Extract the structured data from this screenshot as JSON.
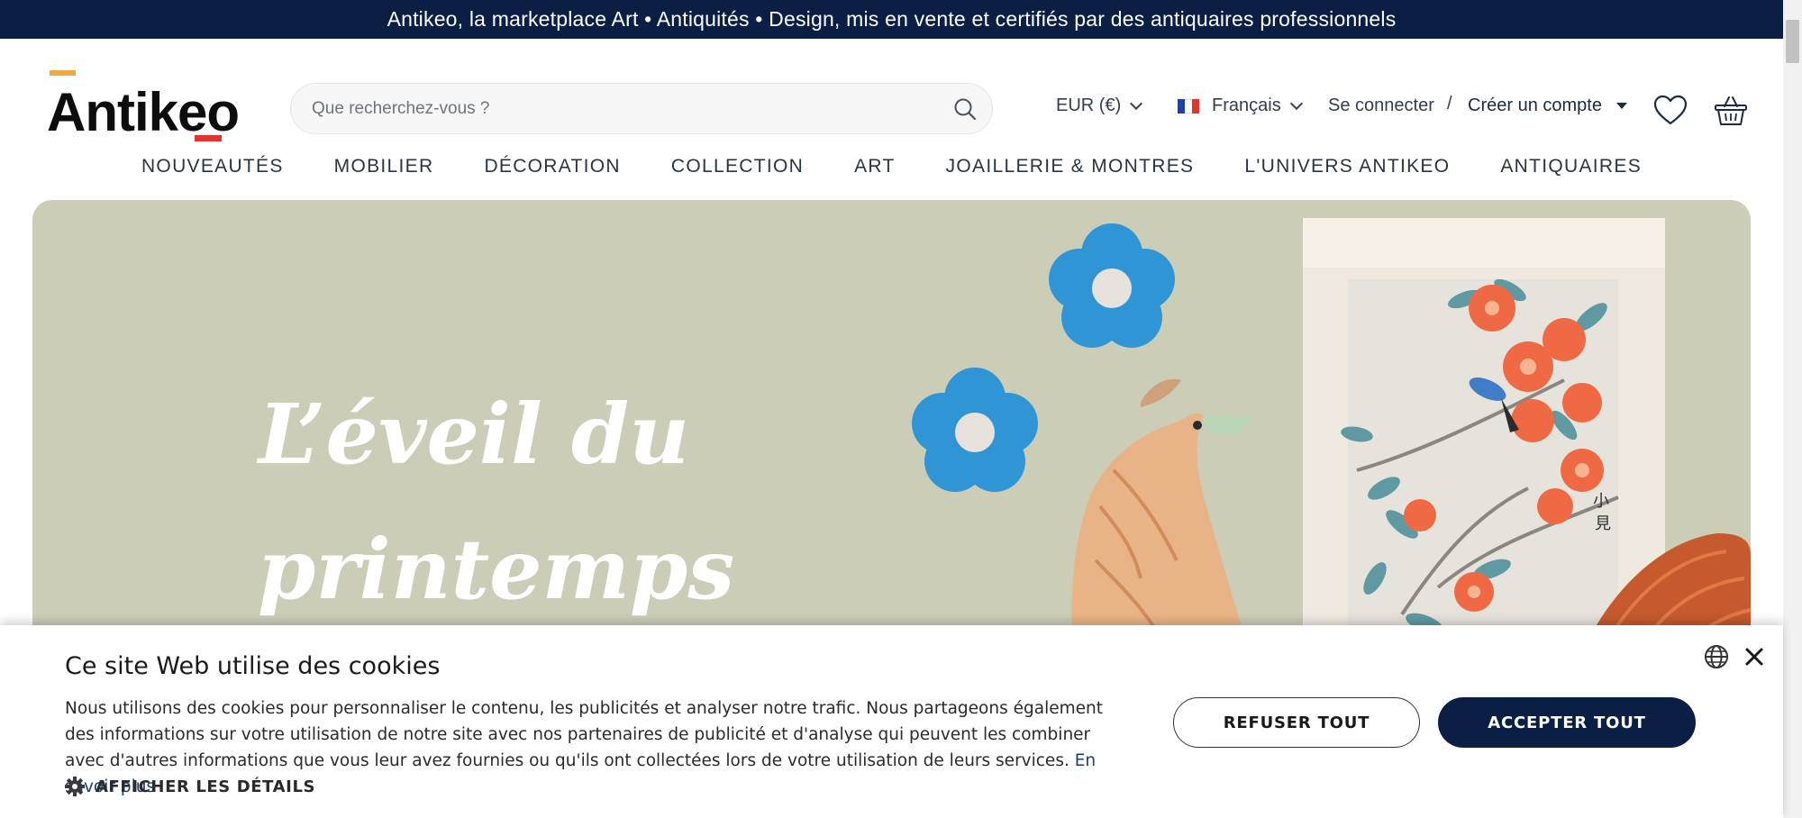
{
  "topbar": {
    "text": "Antikeo, la marketplace Art • Antiquités • Design, mis en vente et certifiés par des antiquaires professionnels"
  },
  "header": {
    "logo_text": "Antikeo",
    "search_placeholder": "Que recherchez-vous ?",
    "currency": "EUR (€)",
    "language": "Français",
    "login": "Se connecter",
    "separator": "/",
    "register": "Créer un compte",
    "icons": [
      "search-icon",
      "heart-icon",
      "basket-icon"
    ]
  },
  "nav": {
    "items": [
      "NOUVEAUTÉS",
      "MOBILIER",
      "DÉCORATION",
      "COLLECTION",
      "ART",
      "JOAILLERIE & MONTRES",
      "L'UNIVERS ANTIKEO",
      "ANTIQUAIRES"
    ]
  },
  "hero": {
    "title_line1": "L’éveil du",
    "title_line2": "printemps",
    "background_color": "#cbcdb6"
  },
  "cookie": {
    "title": "Ce site Web utilise des cookies",
    "body": "Nous utilisons des cookies pour personnaliser le contenu, les publicités et analyser notre trafic. Nous partageons également des informations sur votre utilisation de notre site avec nos partenaires de publicité et d'analyse qui peuvent les combiner avec d'autres informations que vous leur avez fournies ou qu'ils ont collectées lors de votre utilisation de leurs services.",
    "learn_more": "En savoir plus",
    "details": "AFFICHER LES DÉTAILS",
    "refuse": "REFUSER TOUT",
    "accept": "ACCEPTER TOUT"
  },
  "colors": {
    "brand_navy": "#0b1f45",
    "logo_orange": "#f2a93b",
    "logo_red": "#e2332d"
  }
}
